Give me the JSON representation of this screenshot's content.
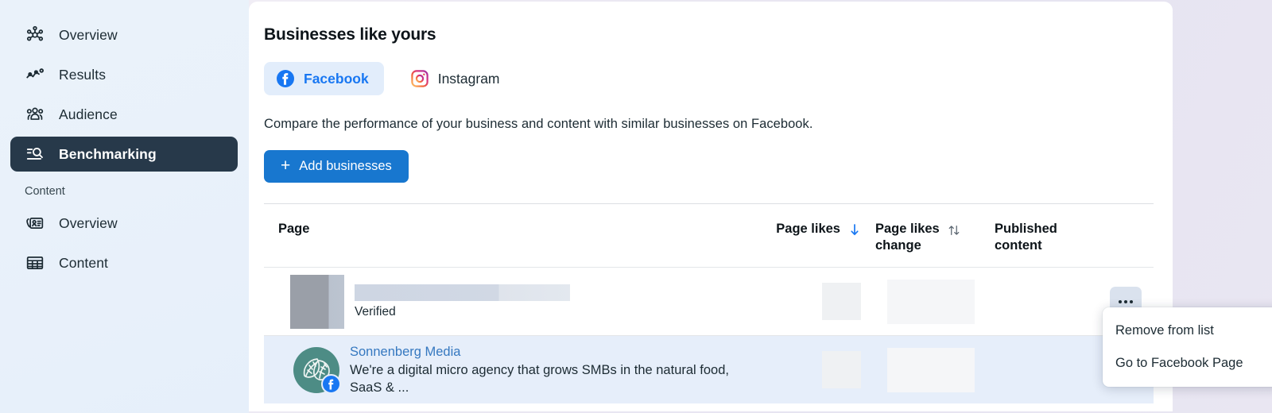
{
  "sidebar": {
    "items": [
      {
        "label": "Overview",
        "icon": "network-nodes-icon",
        "active": false
      },
      {
        "label": "Results",
        "icon": "line-chart-icon",
        "active": false
      },
      {
        "label": "Audience",
        "icon": "people-group-icon",
        "active": false
      },
      {
        "label": "Benchmarking",
        "icon": "list-search-icon",
        "active": true
      }
    ],
    "section_label": "Content",
    "section_items": [
      {
        "label": "Overview",
        "icon": "media-card-icon"
      },
      {
        "label": "Content",
        "icon": "table-grid-icon"
      }
    ]
  },
  "main": {
    "title": "Businesses like yours",
    "tabs": [
      {
        "label": "Facebook",
        "icon": "facebook-icon",
        "selected": true
      },
      {
        "label": "Instagram",
        "icon": "instagram-icon",
        "selected": false
      }
    ],
    "subtitle": "Compare the performance of your business and content with similar businesses on Facebook.",
    "add_button": {
      "plus": "+",
      "label": "Add businesses"
    }
  },
  "table": {
    "columns": {
      "page": "Page",
      "page_likes": "Page likes",
      "page_likes_change_line1": "Page likes",
      "page_likes_change_line2": "change",
      "published_line1": "Published",
      "published_line2": "content"
    },
    "sort": {
      "page_likes_state": "descending",
      "page_likes_change_state": "unsorted",
      "active_color": "#1877f2",
      "inactive_color": "#55606b"
    },
    "rows": [
      {
        "redacted": true,
        "name": "",
        "subtitle": "Verified",
        "page_likes": "",
        "page_likes_change": "",
        "published_content": "",
        "highlighted": false,
        "action_label": "more-options"
      },
      {
        "redacted": false,
        "name": "Sonnenberg Media",
        "subtitle": "We're a digital micro agency that grows SMBs in the natural food, SaaS & ...",
        "page_likes": "",
        "page_likes_change": "",
        "published_content": "",
        "highlighted": true,
        "avatar_color": "#4d8c85",
        "badge": "facebook-icon"
      }
    ]
  },
  "menu": {
    "items": [
      {
        "label": "Remove from list"
      },
      {
        "label": "Go to Facebook Page"
      }
    ]
  },
  "theme": {
    "sidebar_bg": "#eaf1fa",
    "active_nav_bg": "#27394a",
    "brand_blue": "#1877f2",
    "button_blue": "#1877cf",
    "row_highlight": "#e6eefa",
    "page_bg": "#ece9f3"
  }
}
